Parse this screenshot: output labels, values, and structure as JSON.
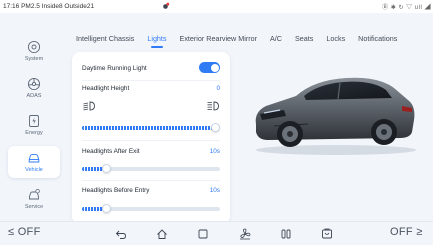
{
  "status_bar": {
    "left_text": "17:16 PM2.5 Inside8 Outside21",
    "right_text": "Ⓑ ✱ ↻ ▽ ull ◢"
  },
  "sidebar": {
    "items": [
      {
        "label": "System",
        "icon": "system-icon"
      },
      {
        "label": "ADAS",
        "icon": "adas-icon"
      },
      {
        "label": "Energy",
        "icon": "energy-icon"
      },
      {
        "label": "Vehicle",
        "icon": "vehicle-icon",
        "active": true
      },
      {
        "label": "Service",
        "icon": "service-icon"
      }
    ]
  },
  "tabs": [
    {
      "label": "Intelligent Chassis"
    },
    {
      "label": "Lights",
      "active": true
    },
    {
      "label": "Exterior Rearview Mirror"
    },
    {
      "label": "A/C"
    },
    {
      "label": "Seats"
    },
    {
      "label": "Locks"
    },
    {
      "label": "Notifications"
    }
  ],
  "lights": {
    "drl_label": "Daytime Running Light",
    "drl_on": true,
    "headlight_height_label": "Headlight Height",
    "headlight_height_value": "0",
    "headlight_height_level": 1.0,
    "after_exit_label": "Headlights After Exit",
    "after_exit_value": "10s",
    "after_exit_level": 0.18,
    "before_entry_label": "Headlights Before Entry",
    "before_entry_value": "10s",
    "before_entry_level": 0.18
  },
  "bottom_bar": {
    "left_temp": "≤ OFF",
    "right_temp": "OFF ≥",
    "icons": [
      "back-icon",
      "home-icon",
      "square-icon",
      "fan-icon",
      "seat-icon",
      "media-icon"
    ]
  },
  "colors": {
    "accent": "#2f7bf5",
    "background": "#f2f5fa",
    "panel": "#ffffff"
  }
}
